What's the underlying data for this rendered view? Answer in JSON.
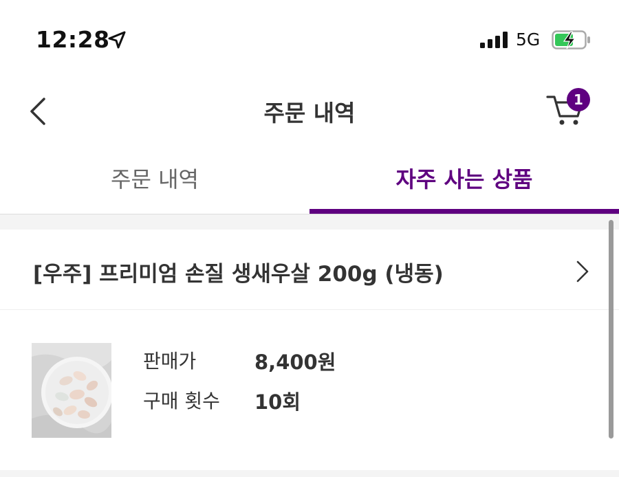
{
  "status_bar": {
    "time": "12:28",
    "network": "5G",
    "icons": [
      "location-arrow-icon",
      "cellular-signal-icon",
      "battery-charging-icon"
    ]
  },
  "nav": {
    "title": "주문 내역",
    "cart_badge": "1",
    "icons": [
      "chevron-left-icon",
      "cart-icon"
    ]
  },
  "tabs": [
    {
      "label": "주문 내역",
      "active": false
    },
    {
      "label": "자주 사는 상품",
      "active": true
    }
  ],
  "accent_color": "#5f0080",
  "product": {
    "name": "[우주] 프리미엄 손질 생새우살 200g (냉동)",
    "price_label": "판매가",
    "price_value": "8,400원",
    "count_label": "구매 횟수",
    "count_value": "10회"
  }
}
